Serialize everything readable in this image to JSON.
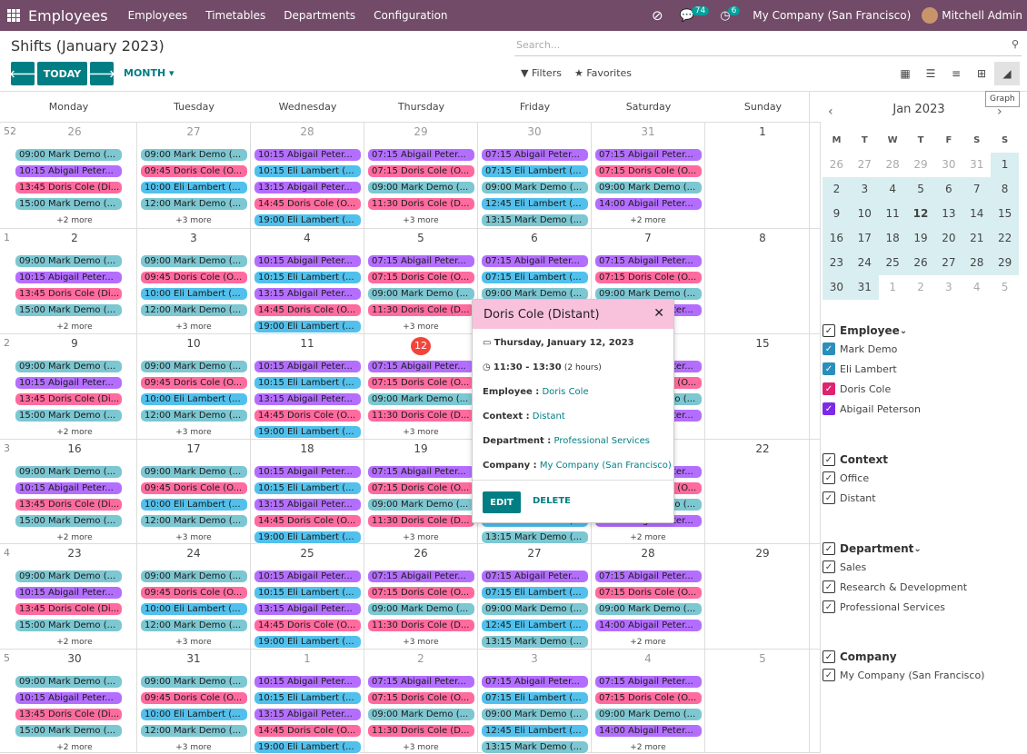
{
  "topbar": {
    "brand": "Employees",
    "menu": [
      "Employees",
      "Timetables",
      "Departments",
      "Configuration"
    ],
    "messages_count": "74",
    "activities_count": "6",
    "company": "My Company (San Francisco)",
    "user": "Mitchell Admin"
  },
  "control": {
    "title": "Shifts (January 2023)",
    "search_placeholder": "Search...",
    "today_label": "TODAY",
    "scale_label": "MONTH",
    "filters_label": "Filters",
    "favorites_label": "Favorites",
    "graph_tooltip": "Graph"
  },
  "calendar": {
    "weekdays": [
      "Monday",
      "Tuesday",
      "Wednesday",
      "Thursday",
      "Friday",
      "Saturday",
      "Sunday"
    ],
    "weeks": [
      {
        "week": "52",
        "days": [
          "26",
          "27",
          "28",
          "29",
          "30",
          "31",
          "1"
        ]
      },
      {
        "week": "1",
        "days": [
          "2",
          "3",
          "4",
          "5",
          "6",
          "7",
          "8"
        ]
      },
      {
        "week": "2",
        "days": [
          "9",
          "10",
          "11",
          "12",
          "13",
          "14",
          "15"
        ]
      },
      {
        "week": "3",
        "days": [
          "16",
          "17",
          "18",
          "19",
          "20",
          "21",
          "22"
        ]
      },
      {
        "week": "4",
        "days": [
          "23",
          "24",
          "25",
          "26",
          "27",
          "28",
          "29"
        ]
      },
      {
        "week": "5",
        "days": [
          "30",
          "31",
          "1",
          "2",
          "3",
          "4",
          "5"
        ]
      }
    ],
    "columns": [
      {
        "events": [
          [
            "09:00 Mark Demo (...",
            "md"
          ],
          [
            "10:15 Abigail Peter...",
            "ap"
          ],
          [
            "13:45 Doris Cole (Di...",
            "dc"
          ],
          [
            "15:00 Mark Demo (...",
            "md"
          ]
        ],
        "more": "+2 more"
      },
      {
        "events": [
          [
            "09:00 Mark Demo (...",
            "md"
          ],
          [
            "09:45 Doris Cole (O...",
            "dc"
          ],
          [
            "10:00 Eli Lambert (...",
            "el"
          ],
          [
            "12:00 Mark Demo (...",
            "md"
          ]
        ],
        "more": "+3 more"
      },
      {
        "events": [
          [
            "10:15 Abigail Peter...",
            "ap"
          ],
          [
            "10:15 Eli Lambert (...",
            "el"
          ],
          [
            "13:15 Abigail Peter...",
            "ap"
          ],
          [
            "14:45 Doris Cole (O...",
            "dc"
          ],
          [
            "19:00 Eli Lambert (...",
            "el"
          ]
        ],
        "more": ""
      },
      {
        "events": [
          [
            "07:15 Abigail Peter...",
            "ap"
          ],
          [
            "07:15 Doris Cole (O...",
            "dc"
          ],
          [
            "09:00 Mark Demo (...",
            "md"
          ],
          [
            "11:30 Doris Cole (D...",
            "dc"
          ]
        ],
        "more": "+3 more"
      },
      {
        "events": [
          [
            "07:15 Abigail Peter...",
            "ap"
          ],
          [
            "07:15 Eli Lambert (...",
            "el"
          ],
          [
            "09:00 Mark Demo (...",
            "md"
          ],
          [
            "12:45 Eli Lambert (...",
            "el"
          ],
          [
            "13:15 Mark Demo (...",
            "md"
          ]
        ],
        "more": ""
      },
      {
        "events": [
          [
            "07:15 Abigail Peter...",
            "ap"
          ],
          [
            "07:15 Doris Cole (O...",
            "dc"
          ],
          [
            "09:00 Mark Demo (...",
            "md"
          ],
          [
            "14:00 Abigail Peter...",
            "ap"
          ]
        ],
        "more": "+2 more"
      }
    ],
    "today_day": "12"
  },
  "popup": {
    "title": "Doris Cole (Distant)",
    "date": "Thursday, January 12, 2023",
    "time": "11:30 - 13:30",
    "duration": "(2 hours)",
    "employee_label": "Employee :",
    "employee": "Doris Cole",
    "context_label": "Context :",
    "context": "Distant",
    "department_label": "Department :",
    "department": "Professional Services",
    "company_label": "Company :",
    "company": "My Company (San Francisco)",
    "edit_label": "EDIT",
    "delete_label": "DELETE"
  },
  "sidebar": {
    "month": "Jan 2023",
    "dow": [
      "M",
      "T",
      "W",
      "T",
      "F",
      "S",
      "S"
    ],
    "weeks": [
      [
        "26",
        "27",
        "28",
        "29",
        "30",
        "31",
        "1"
      ],
      [
        "2",
        "3",
        "4",
        "5",
        "6",
        "7",
        "8"
      ],
      [
        "9",
        "10",
        "11",
        "12",
        "13",
        "14",
        "15"
      ],
      [
        "16",
        "17",
        "18",
        "19",
        "20",
        "21",
        "22"
      ],
      [
        "23",
        "24",
        "25",
        "26",
        "27",
        "28",
        "29"
      ],
      [
        "30",
        "31",
        "1",
        "2",
        "3",
        "4",
        "5"
      ]
    ],
    "filters": [
      {
        "title": "Employee",
        "items": [
          [
            "Mark Demo",
            "#2a8fbd"
          ],
          [
            "Eli Lambert",
            "#2a8fbd"
          ],
          [
            "Doris Cole",
            "#e0236f"
          ],
          [
            "Abigail Peterson",
            "#7d2ae8"
          ]
        ]
      },
      {
        "title": "Context",
        "items": [
          [
            "Office",
            ""
          ],
          [
            "Distant",
            ""
          ]
        ]
      },
      {
        "title": "Department",
        "items": [
          [
            "Sales",
            ""
          ],
          [
            "Research & Development",
            ""
          ],
          [
            "Professional Services",
            ""
          ]
        ]
      },
      {
        "title": "Company",
        "items": [
          [
            "My Company (San Francisco)",
            ""
          ]
        ]
      }
    ]
  }
}
